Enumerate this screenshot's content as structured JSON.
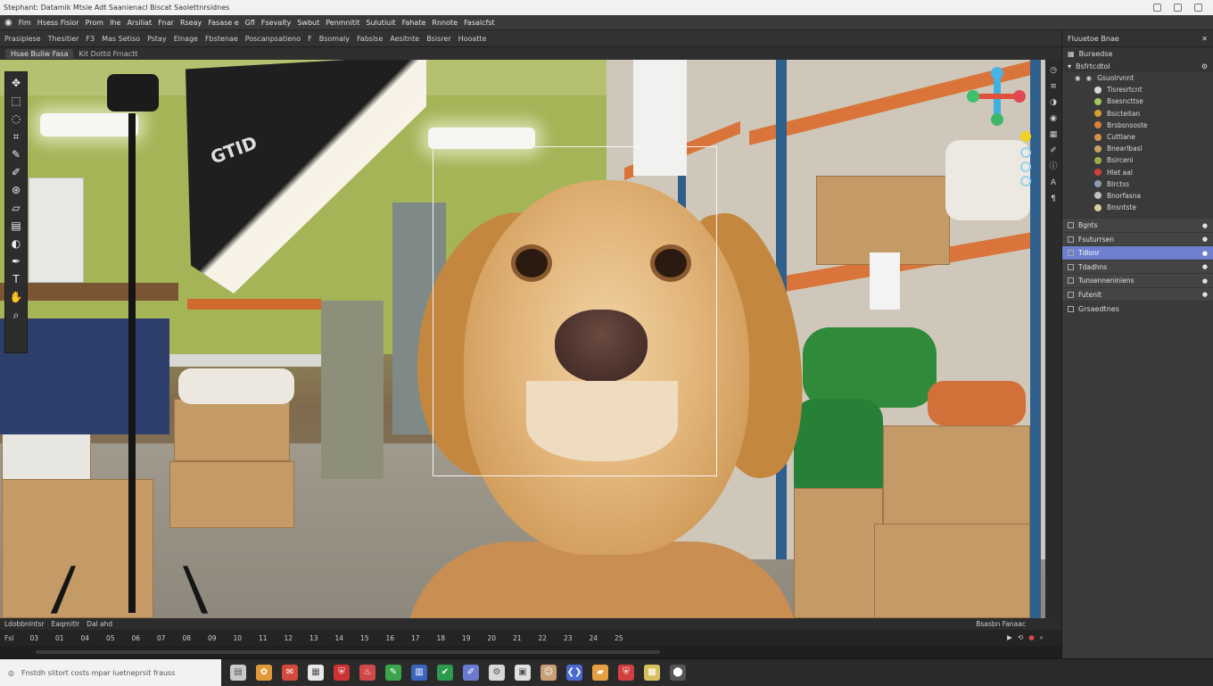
{
  "window": {
    "title": "Stephant: Datamik Mtsie Adt Saanienacl Biscat Saolettnrsidnes"
  },
  "menubar": {
    "items": [
      "Fim",
      "Hsess Fisior",
      "Prom",
      "Ihe",
      "Arsiliat",
      "Fnar",
      "Rseay",
      "Fasase e",
      "Gfl",
      "Fsevalty",
      "Swbut",
      "Penmnitit",
      "Sulutiuit",
      "Fahate",
      "Rnnote",
      "Fasalcfst"
    ]
  },
  "optionsbar": {
    "items": [
      "Prasiplese",
      "Thesitier",
      "F3",
      "Mas Setiso",
      "Pstay",
      "Elnage",
      "Fbstenae",
      "Poscanpsatieno",
      "F",
      "Bsomaly",
      "Fabslse",
      "Aesitnte",
      "Bsisrer",
      "Hooatte"
    ]
  },
  "document": {
    "tab_label": "Hsae Buliw Fasa",
    "sub_label": "Kit Dottd Frnactt"
  },
  "tools": [
    {
      "icon": "move-tool-icon",
      "glyph": "✥"
    },
    {
      "icon": "marquee-tool-icon",
      "glyph": "⬚"
    },
    {
      "icon": "lasso-tool-icon",
      "glyph": "◌"
    },
    {
      "icon": "crop-tool-icon",
      "glyph": "⌗"
    },
    {
      "icon": "eyedropper-tool-icon",
      "glyph": "✎"
    },
    {
      "icon": "brush-tool-icon",
      "glyph": "✐"
    },
    {
      "icon": "stamp-tool-icon",
      "glyph": "⊛"
    },
    {
      "icon": "eraser-tool-icon",
      "glyph": "▱"
    },
    {
      "icon": "gradient-tool-icon",
      "glyph": "▤"
    },
    {
      "icon": "dodge-tool-icon",
      "glyph": "◐"
    },
    {
      "icon": "pen-tool-icon",
      "glyph": "✒"
    },
    {
      "icon": "text-tool-icon",
      "glyph": "T"
    },
    {
      "icon": "hand-tool-icon",
      "glyph": "✋"
    },
    {
      "icon": "zoom-tool-icon",
      "glyph": "⌕"
    }
  ],
  "right_panel": {
    "header": "Fluuetoe Bnae",
    "sub_header": "Buraedse",
    "group_label": "Bsfrtcdtol",
    "root_item": "Gsuolrvnnt",
    "tree_items": [
      {
        "label": "Tisresrtcnt",
        "color": "#d9d9d9"
      },
      {
        "label": "Bsesncttse",
        "color": "#a5c85c"
      },
      {
        "label": "Bsicteitan",
        "color": "#d5a032"
      },
      {
        "label": "Brsbsnsoste",
        "color": "#e0803a"
      },
      {
        "label": "Cuttlane",
        "color": "#d89050"
      },
      {
        "label": "Bnearlbasl",
        "color": "#c8a060"
      },
      {
        "label": "Bsirceni",
        "color": "#9ab04a"
      },
      {
        "label": "Hlet aal",
        "color": "#d04040"
      },
      {
        "label": "Blrctss",
        "color": "#8a9ab0"
      },
      {
        "label": "Bnorfasna",
        "color": "#c0c0c0"
      },
      {
        "label": "Bnsntste",
        "color": "#d8cfa0"
      }
    ],
    "layers": [
      {
        "label": "Bgnts",
        "selected": false
      },
      {
        "label": "Fsuturrsen",
        "selected": false
      },
      {
        "label": "Tdlonr",
        "selected": true
      },
      {
        "label": "Tdadhns",
        "selected": false
      },
      {
        "label": "Tunsenneniniens",
        "selected": false
      },
      {
        "label": "Futenlt",
        "selected": false
      }
    ],
    "footer_label": "Grsaedtnes"
  },
  "timeline": {
    "header_items": [
      "Ldobbnlntsr",
      "Eaqmitlr",
      "Dal ahd"
    ],
    "ticks": [
      "Fsl",
      "03",
      "01",
      "04",
      "05",
      "06",
      "07",
      "08",
      "09",
      "10",
      "11",
      "12",
      "13",
      "14",
      "15",
      "16",
      "17",
      "18",
      "19",
      "20",
      "21",
      "22",
      "23",
      "24",
      "25"
    ],
    "right_label": "Bsasbn Fanaac"
  },
  "taskbar": {
    "search_text": "Fnstdh slitort costs mpar luetneprsit frauss",
    "apps": [
      {
        "icon": "files-icon",
        "color": "#c9c9c9"
      },
      {
        "icon": "photos-icon",
        "color": "#e09a3a"
      },
      {
        "icon": "mail-icon",
        "color": "#d24a3a"
      },
      {
        "icon": "calendar-icon",
        "color": "#e8e8e8"
      },
      {
        "icon": "shield-icon",
        "color": "#cc3333"
      },
      {
        "icon": "store-icon",
        "color": "#d04848"
      },
      {
        "icon": "notes-icon",
        "color": "#3aa54a"
      },
      {
        "icon": "book-icon",
        "color": "#3a66c0"
      },
      {
        "icon": "sheets-icon",
        "color": "#2e9a4e"
      },
      {
        "icon": "paint-icon",
        "color": "#6a7ad0"
      },
      {
        "icon": "settings-icon",
        "color": "#d8d8d8"
      },
      {
        "icon": "gallery-icon",
        "color": "#e0e0e0"
      },
      {
        "icon": "contacts-icon",
        "color": "#c8a078"
      },
      {
        "icon": "code-icon",
        "color": "#4a6ad0"
      },
      {
        "icon": "folder-icon",
        "color": "#e6a040"
      },
      {
        "icon": "antivirus-icon",
        "color": "#d04040"
      },
      {
        "icon": "archive-icon",
        "color": "#d8c060"
      },
      {
        "icon": "launcher-icon",
        "color": "#555555"
      }
    ]
  },
  "colors": {
    "accent": "#6f7fcf",
    "canvas_bg": "#a4b456",
    "shelf": "#d9743a",
    "dog": "#d7a264"
  }
}
